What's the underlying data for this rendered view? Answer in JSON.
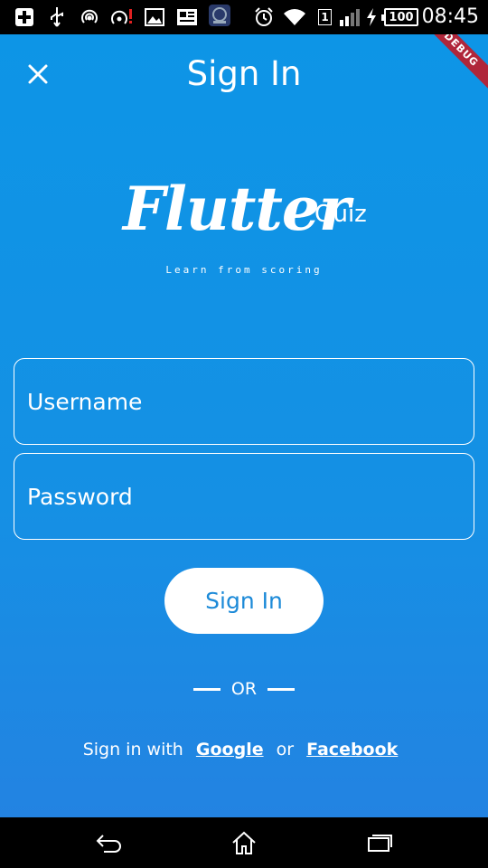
{
  "status_bar": {
    "time": "08:45",
    "battery": "100",
    "sim": "1",
    "icons": [
      "add-icon",
      "usb-icon",
      "hotspot-icon",
      "wifi-alert-icon",
      "image-icon",
      "news-icon",
      "app-icon",
      "alarm-icon",
      "wifi-icon",
      "signal-icon",
      "charging-icon"
    ]
  },
  "app": {
    "debug_label": "DEBUG",
    "title": "Sign In",
    "logo": {
      "main": "Flutter",
      "sub": "Quiz",
      "tagline": "Learn from scoring"
    },
    "form": {
      "username_placeholder": "Username",
      "password_placeholder": "Password",
      "submit_label": "Sign In"
    },
    "divider_label": "OR",
    "social": {
      "prefix": "Sign in with",
      "google": "Google",
      "connector": "or",
      "facebook": "Facebook"
    },
    "colors": {
      "background": "#0d95e6",
      "button_text": "#1c8ad8",
      "ribbon": "#b0263a"
    }
  },
  "nav_bar": {
    "icons": [
      "back-icon",
      "home-icon",
      "recents-icon"
    ]
  }
}
